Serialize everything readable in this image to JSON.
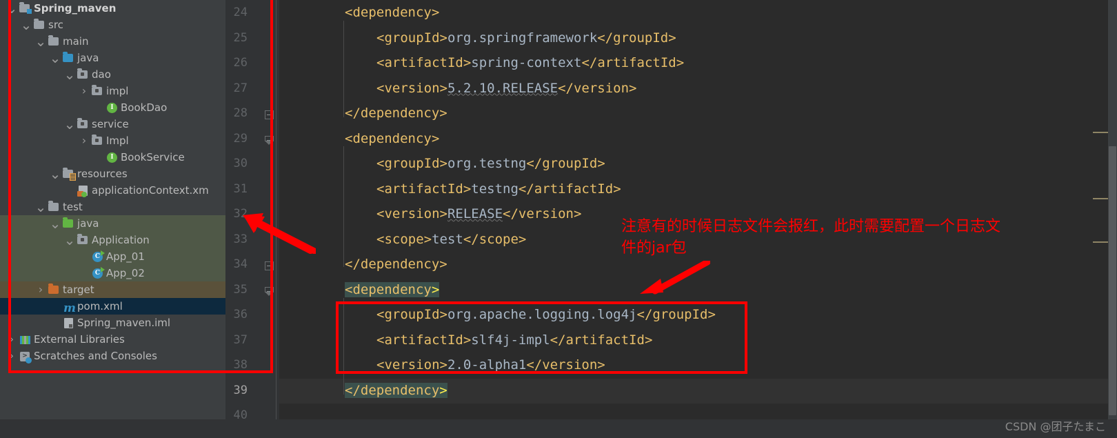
{
  "window": {
    "background": "#2b2b2b",
    "panel_background": "#3c3f41",
    "gutter_background": "#313335",
    "accent_annotation": "#ff0000"
  },
  "project_tree": {
    "name": "Project tool window",
    "items": [
      {
        "label": "Spring_maven",
        "indent": 0,
        "arrow": "chevron-down",
        "icon": "module-folder-icon",
        "bold": true,
        "row_state": "normal"
      },
      {
        "label": "src",
        "indent": 1,
        "arrow": "chevron-down",
        "icon": "folder-icon",
        "bold": false,
        "row_state": "normal"
      },
      {
        "label": "main",
        "indent": 2,
        "arrow": "chevron-down",
        "icon": "folder-icon",
        "bold": false,
        "row_state": "normal"
      },
      {
        "label": "java",
        "indent": 3,
        "arrow": "chevron-down",
        "icon": "source-root-folder-icon",
        "bold": false,
        "row_state": "normal"
      },
      {
        "label": "dao",
        "indent": 4,
        "arrow": "chevron-down",
        "icon": "package-folder-icon",
        "bold": false,
        "row_state": "normal"
      },
      {
        "label": "impl",
        "indent": 5,
        "arrow": "chevron-right",
        "icon": "package-folder-icon",
        "bold": false,
        "row_state": "normal"
      },
      {
        "label": "BookDao",
        "indent": 6,
        "arrow": "none",
        "icon": "interface-icon",
        "bold": false,
        "row_state": "normal"
      },
      {
        "label": "service",
        "indent": 4,
        "arrow": "chevron-down",
        "icon": "package-folder-icon",
        "bold": false,
        "row_state": "normal"
      },
      {
        "label": "Impl",
        "indent": 5,
        "arrow": "chevron-right",
        "icon": "package-folder-icon",
        "bold": false,
        "row_state": "normal"
      },
      {
        "label": "BookService",
        "indent": 6,
        "arrow": "none",
        "icon": "interface-icon",
        "bold": false,
        "row_state": "normal"
      },
      {
        "label": "resources",
        "indent": 3,
        "arrow": "chevron-down",
        "icon": "resources-folder-icon",
        "bold": false,
        "row_state": "normal"
      },
      {
        "label": "applicationContext.xm",
        "indent": 4,
        "arrow": "none",
        "icon": "spring-xml-file-icon",
        "bold": false,
        "row_state": "normal"
      },
      {
        "label": "test",
        "indent": 2,
        "arrow": "chevron-down",
        "icon": "folder-icon",
        "bold": false,
        "row_state": "normal"
      },
      {
        "label": "java",
        "indent": 3,
        "arrow": "chevron-down",
        "icon": "test-source-folder-icon",
        "bold": false,
        "row_state": "green"
      },
      {
        "label": "Application",
        "indent": 4,
        "arrow": "chevron-down",
        "icon": "package-folder-icon",
        "bold": false,
        "row_state": "green"
      },
      {
        "label": "App_01",
        "indent": 5,
        "arrow": "none",
        "icon": "runnable-class-icon",
        "bold": false,
        "row_state": "green"
      },
      {
        "label": "App_02",
        "indent": 5,
        "arrow": "none",
        "icon": "runnable-class-icon",
        "bold": false,
        "row_state": "green"
      },
      {
        "label": "target",
        "indent": 2,
        "arrow": "chevron-right",
        "icon": "excluded-folder-icon",
        "bold": false,
        "row_state": "brown"
      },
      {
        "label": "pom.xml",
        "indent": 3,
        "arrow": "none",
        "icon": "maven-pom-icon",
        "bold": false,
        "row_state": "selected"
      },
      {
        "label": "Spring_maven.iml",
        "indent": 3,
        "arrow": "none",
        "icon": "iml-file-icon",
        "bold": false,
        "row_state": "normal"
      },
      {
        "label": "External Libraries",
        "indent": 0,
        "arrow": "chevron-right",
        "icon": "libraries-icon",
        "bold": false,
        "row_state": "normal"
      },
      {
        "label": "Scratches and Consoles",
        "indent": 0,
        "arrow": "chevron-right",
        "icon": "scratches-icon",
        "bold": false,
        "row_state": "normal"
      }
    ]
  },
  "gutter": {
    "name": "line-number-gutter",
    "line_numbers": [
      "24",
      "25",
      "26",
      "27",
      "28",
      "29",
      "30",
      "31",
      "32",
      "33",
      "34",
      "35",
      "36",
      "37",
      "38",
      "39",
      "40"
    ],
    "current_line": "39",
    "fold_markers": [
      {
        "line": "28",
        "type": "fold-start"
      },
      {
        "line": "29",
        "type": "fold-end"
      },
      {
        "line": "34",
        "type": "fold-start"
      },
      {
        "line": "35",
        "type": "fold-end"
      }
    ]
  },
  "editor": {
    "file": "pom.xml",
    "lines": [
      {
        "n": "24",
        "indent": 0,
        "parts": [
          {
            "t": "tag",
            "s": "<dependency>"
          }
        ]
      },
      {
        "n": "25",
        "indent": 1,
        "parts": [
          {
            "t": "tag",
            "s": "<groupId>"
          },
          {
            "t": "val",
            "s": "org.springframework"
          },
          {
            "t": "tag",
            "s": "</groupId>"
          }
        ]
      },
      {
        "n": "26",
        "indent": 1,
        "parts": [
          {
            "t": "tag",
            "s": "<artifactId>"
          },
          {
            "t": "val",
            "s": "spring-context"
          },
          {
            "t": "tag",
            "s": "</artifactId>"
          }
        ]
      },
      {
        "n": "27",
        "indent": 1,
        "parts": [
          {
            "t": "tag",
            "s": "<version>"
          },
          {
            "t": "val-wavy",
            "s": "5.2.10.RELEASE"
          },
          {
            "t": "tag",
            "s": "</version>"
          }
        ]
      },
      {
        "n": "28",
        "indent": 0,
        "parts": [
          {
            "t": "tag",
            "s": "</dependency>"
          }
        ]
      },
      {
        "n": "29",
        "indent": 0,
        "parts": [
          {
            "t": "tag",
            "s": "<dependency>"
          }
        ]
      },
      {
        "n": "30",
        "indent": 1,
        "parts": [
          {
            "t": "tag",
            "s": "<groupId>"
          },
          {
            "t": "val",
            "s": "org.testng"
          },
          {
            "t": "tag",
            "s": "</groupId>"
          }
        ]
      },
      {
        "n": "31",
        "indent": 1,
        "parts": [
          {
            "t": "tag",
            "s": "<artifactId>"
          },
          {
            "t": "val",
            "s": "testng"
          },
          {
            "t": "tag",
            "s": "</artifactId>"
          }
        ]
      },
      {
        "n": "32",
        "indent": 1,
        "parts": [
          {
            "t": "tag",
            "s": "<version>"
          },
          {
            "t": "val-wavy",
            "s": "RELEASE"
          },
          {
            "t": "tag",
            "s": "</version>"
          }
        ]
      },
      {
        "n": "33",
        "indent": 1,
        "parts": [
          {
            "t": "tag",
            "s": "<scope>"
          },
          {
            "t": "val",
            "s": "test"
          },
          {
            "t": "tag",
            "s": "</scope>"
          }
        ]
      },
      {
        "n": "34",
        "indent": 0,
        "parts": [
          {
            "t": "tag",
            "s": "</dependency>"
          }
        ]
      },
      {
        "n": "35",
        "indent": 0,
        "highlight": true,
        "parts": [
          {
            "t": "tag",
            "s": "<dependency"
          },
          {
            "t": "gt",
            "s": ">"
          }
        ]
      },
      {
        "n": "36",
        "indent": 1,
        "parts": [
          {
            "t": "tag",
            "s": "<groupId>"
          },
          {
            "t": "val",
            "s": "org.apache.logging.log4j"
          },
          {
            "t": "tag",
            "s": "</groupId>"
          }
        ]
      },
      {
        "n": "37",
        "indent": 1,
        "parts": [
          {
            "t": "tag",
            "s": "<artifactId>"
          },
          {
            "t": "val",
            "s": "slf4j-impl"
          },
          {
            "t": "tag",
            "s": "</artifactId>"
          }
        ]
      },
      {
        "n": "38",
        "indent": 1,
        "parts": [
          {
            "t": "tag",
            "s": "<version>"
          },
          {
            "t": "val",
            "s": "2.0-alpha1"
          },
          {
            "t": "tag",
            "s": "</version>"
          }
        ]
      },
      {
        "n": "39",
        "indent": 0,
        "highlight": true,
        "parts": [
          {
            "t": "tag",
            "s": "</dependency"
          },
          {
            "t": "gt",
            "s": ">"
          }
        ]
      },
      {
        "n": "40",
        "indent": 0,
        "parts": []
      }
    ]
  },
  "annotations": {
    "note_text": "注意有的时候日志文件会报红，此时需要配置一个日志文\n件的jar包",
    "note_color": "#ff0000",
    "arrow_to_tree": "arrow-pointing-left-at-project-tree",
    "arrow_to_dependency": "arrow-pointing-at-log4j-dependency",
    "box_tree": "red-rectangle-around-project-tree",
    "box_code": "red-rectangle-around-log4j-dependency-body"
  },
  "watermark": {
    "text": "CSDN @团子たまこ"
  }
}
